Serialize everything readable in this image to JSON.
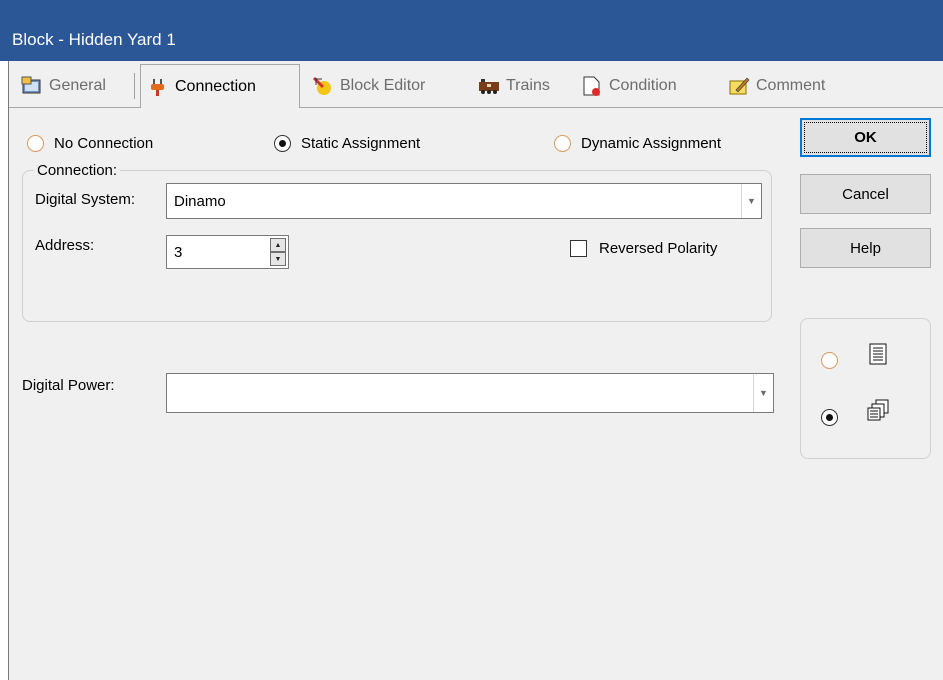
{
  "window": {
    "title": "Block - Hidden Yard 1"
  },
  "tabs": [
    {
      "label": "General",
      "icon": "general-icon",
      "active": false
    },
    {
      "label": "Connection",
      "icon": "plug-icon",
      "active": true
    },
    {
      "label": "Block Editor",
      "icon": "block-editor-icon",
      "active": false
    },
    {
      "label": "Trains",
      "icon": "trains-icon",
      "active": false
    },
    {
      "label": "Condition",
      "icon": "condition-icon",
      "active": false
    },
    {
      "label": "Comment",
      "icon": "comment-icon",
      "active": false
    }
  ],
  "assignment": {
    "options": [
      {
        "label": "No Connection",
        "selected": false
      },
      {
        "label": "Static Assignment",
        "selected": true
      },
      {
        "label": "Dynamic Assignment",
        "selected": false
      }
    ]
  },
  "connection": {
    "group_label": "Connection:",
    "digital_system_label": "Digital System:",
    "digital_system_value": "Dinamo",
    "address_label": "Address:",
    "address_value": "3",
    "reversed_polarity_label": "Reversed Polarity",
    "reversed_polarity_checked": false
  },
  "digital_power": {
    "label": "Digital Power:",
    "value": ""
  },
  "buttons": {
    "ok": "OK",
    "cancel": "Cancel",
    "help": "Help"
  },
  "view_mode": [
    {
      "icon": "single-page-icon",
      "selected": false
    },
    {
      "icon": "multi-page-icon",
      "selected": true
    }
  ],
  "colors": {
    "titlebar": "#2b5797",
    "dialog_bg": "#f0f0f0",
    "focus_border": "#0078d7"
  }
}
